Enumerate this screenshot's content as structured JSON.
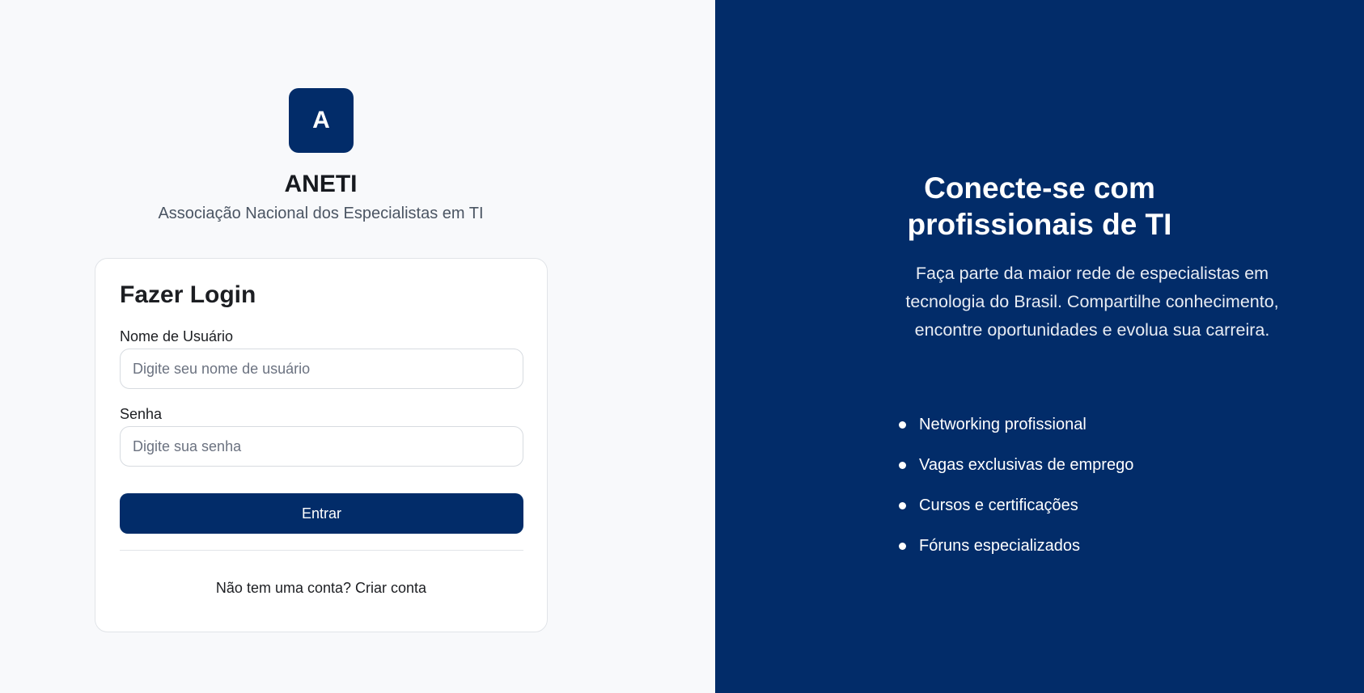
{
  "brand": {
    "logo_letter": "A",
    "name": "ANETI",
    "subtitle": "Associação Nacional dos Especialistas em TI"
  },
  "login": {
    "title": "Fazer Login",
    "username_label": "Nome de Usuário",
    "username_placeholder": "Digite seu nome de usuário",
    "password_label": "Senha",
    "password_placeholder": "Digite sua senha",
    "submit_label": "Entrar",
    "signup_prompt": "Não tem uma conta?",
    "signup_link": "Criar conta"
  },
  "hero": {
    "title_line1": "Conecte-se com",
    "title_line2": "profissionais de TI",
    "description": "Faça parte da maior rede de especialistas em tecnologia do Brasil. Compartilhe conhecimento, encontre oportunidades e evolua sua carreira.",
    "features": [
      "Networking profissional",
      "Vagas exclusivas de emprego",
      "Cursos e certificações",
      "Fóruns especializados"
    ]
  },
  "colors": {
    "primary": "#022c69",
    "background_left": "#f8f9fb",
    "card": "#ffffff"
  }
}
